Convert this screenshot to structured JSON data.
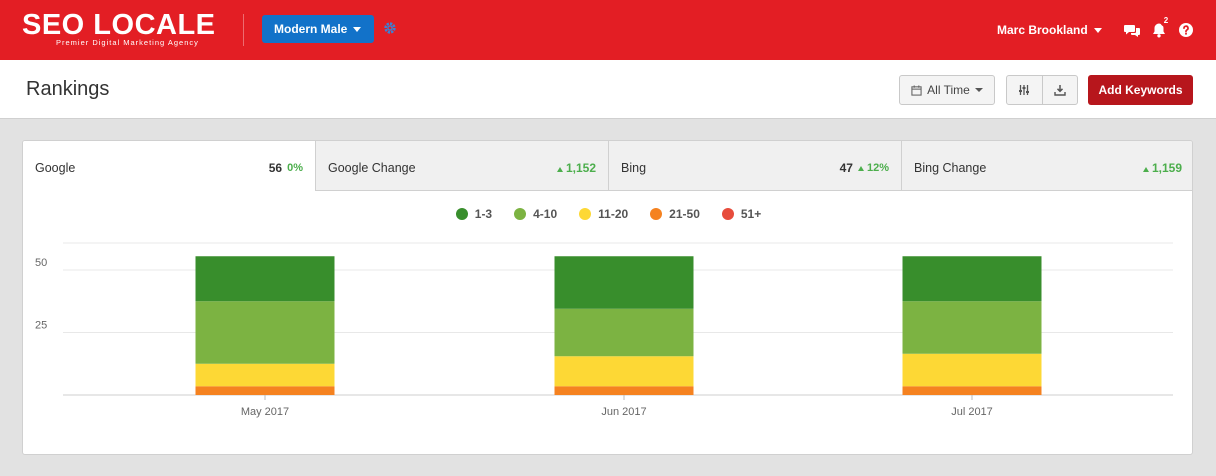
{
  "header": {
    "logo_text": "SEO LOCALE",
    "logo_tagline": "Premier Digital Marketing Agency",
    "account_selector": "Modern Male",
    "user_name": "Marc Brookland",
    "notification_count": "2",
    "icons": [
      "settings-gear-icon",
      "chat-icon",
      "bell-icon",
      "help-icon"
    ]
  },
  "page": {
    "title": "Rankings",
    "time_filter_label": "All Time",
    "add_keywords_label": "Add Keywords"
  },
  "tabs": [
    {
      "name": "Google",
      "value": "56",
      "change": "0%"
    },
    {
      "name": "Google Change",
      "change": "1,152"
    },
    {
      "name": "Bing",
      "value": "47",
      "change": "12%"
    },
    {
      "name": "Bing Change",
      "change": "1,159"
    }
  ],
  "colors": {
    "brand_red": "#e31e24",
    "account_blue": "#1272c9",
    "positive_green": "#4cae4c"
  },
  "chart_data": {
    "type": "bar",
    "stacked": true,
    "categories": [
      "May 2017",
      "Jun 2017",
      "Jul 2017"
    ],
    "ylim": [
      0,
      60
    ],
    "yticks": [
      25,
      50
    ],
    "grid": true,
    "legend_position": "top-center",
    "series": [
      {
        "name": "51+",
        "color": "#e74c3c",
        "values": [
          0,
          0,
          0
        ]
      },
      {
        "name": "21-50",
        "color": "#f58220",
        "values": [
          3.5,
          3.5,
          3.5
        ]
      },
      {
        "name": "11-20",
        "color": "#fdd835",
        "values": [
          9,
          12,
          13
        ]
      },
      {
        "name": "4-10",
        "color": "#7cb342",
        "values": [
          25,
          19,
          21
        ]
      },
      {
        "name": "1-3",
        "color": "#388e2c",
        "values": [
          18,
          21,
          18
        ]
      }
    ],
    "legend_order": [
      "1-3",
      "4-10",
      "11-20",
      "21-50",
      "51+"
    ]
  }
}
